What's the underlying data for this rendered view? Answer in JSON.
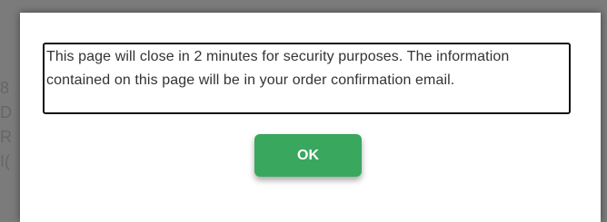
{
  "dialog": {
    "message": "This page will close in 2 minutes for security purposes. The information contained on this page will be in your order confirmation email.",
    "ok_label": "OK"
  },
  "background": {
    "partial_lines": [
      "8",
      "D",
      "R",
      "I("
    ]
  },
  "colors": {
    "overlay": "#8f8f8f",
    "modal_background": "#ffffff",
    "message_border": "#111111",
    "ok_button": "#3aa75e",
    "ok_text": "#ffffff"
  }
}
